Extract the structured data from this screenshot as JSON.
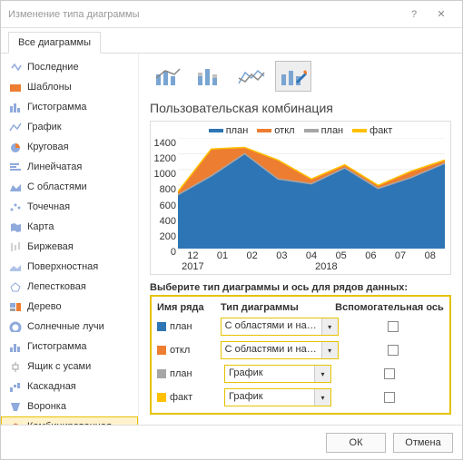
{
  "window": {
    "title": "Изменение типа диаграммы",
    "help": "?",
    "close": "✕"
  },
  "tabs": {
    "all": "Все диаграммы"
  },
  "sidebar": {
    "items": [
      {
        "label": "Последние",
        "icon": "recent"
      },
      {
        "label": "Шаблоны",
        "icon": "templates"
      },
      {
        "label": "Гистограмма",
        "icon": "bar-v"
      },
      {
        "label": "График",
        "icon": "line"
      },
      {
        "label": "Круговая",
        "icon": "pie"
      },
      {
        "label": "Линейчатая",
        "icon": "bar-h"
      },
      {
        "label": "С областями",
        "icon": "area"
      },
      {
        "label": "Точечная",
        "icon": "scatter"
      },
      {
        "label": "Карта",
        "icon": "map"
      },
      {
        "label": "Биржевая",
        "icon": "stock"
      },
      {
        "label": "Поверхностная",
        "icon": "surface"
      },
      {
        "label": "Лепестковая",
        "icon": "radar"
      },
      {
        "label": "Дерево",
        "icon": "tree"
      },
      {
        "label": "Солнечные лучи",
        "icon": "sunburst"
      },
      {
        "label": "Гистограмма",
        "icon": "histogram"
      },
      {
        "label": "Ящик с усами",
        "icon": "boxplot"
      },
      {
        "label": "Каскадная",
        "icon": "waterfall"
      },
      {
        "label": "Воронка",
        "icon": "funnel"
      },
      {
        "label": "Комбинированная",
        "icon": "combo",
        "selected": true
      }
    ]
  },
  "main": {
    "heading": "Пользовательская комбинация",
    "legend": [
      {
        "name": "план",
        "color": "#2e75b6"
      },
      {
        "name": "откл",
        "color": "#ed7d31"
      },
      {
        "name": "план",
        "color": "#a6a6a6"
      },
      {
        "name": "факт",
        "color": "#ffc000"
      }
    ],
    "config_label": "Выберите тип диаграммы и ось для рядов данных:",
    "headers": {
      "name": "Имя ряда",
      "type": "Тип диаграммы",
      "axis": "Вспомогательная ось"
    },
    "rows": [
      {
        "name": "план",
        "color": "#2e75b6",
        "type": "С областями и нако…",
        "aux": false
      },
      {
        "name": "откл",
        "color": "#ed7d31",
        "type": "С областями и нако…",
        "aux": false
      },
      {
        "name": "план",
        "color": "#a6a6a6",
        "type": "График",
        "aux": false
      },
      {
        "name": "факт",
        "color": "#ffc000",
        "type": "График",
        "aux": false
      }
    ]
  },
  "footer": {
    "ok": "ОК",
    "cancel": "Отмена"
  },
  "chart_data": {
    "type": "area",
    "x_year_groups": [
      "2017",
      "2018"
    ],
    "x": [
      "12",
      "01",
      "02",
      "03",
      "04",
      "05",
      "06",
      "07",
      "08"
    ],
    "ylim": [
      0,
      1400
    ],
    "yticks": [
      0,
      200,
      400,
      600,
      800,
      1000,
      1200,
      1400
    ],
    "series": [
      {
        "name": "план",
        "type": "area",
        "color": "#2e75b6",
        "values": [
          680,
          920,
          1200,
          880,
          820,
          1020,
          760,
          900,
          1080
        ]
      },
      {
        "name": "откл",
        "type": "area",
        "color": "#ed7d31",
        "values": [
          40,
          340,
          80,
          240,
          60,
          40,
          40,
          80,
          40
        ]
      },
      {
        "name": "план",
        "type": "line",
        "color": "#a6a6a6",
        "values": [
          680,
          920,
          1200,
          880,
          820,
          1020,
          760,
          900,
          1080
        ]
      },
      {
        "name": "факт",
        "type": "line",
        "color": "#ffc000",
        "values": [
          720,
          1260,
          1280,
          1120,
          880,
          1060,
          800,
          980,
          1120
        ]
      }
    ]
  }
}
